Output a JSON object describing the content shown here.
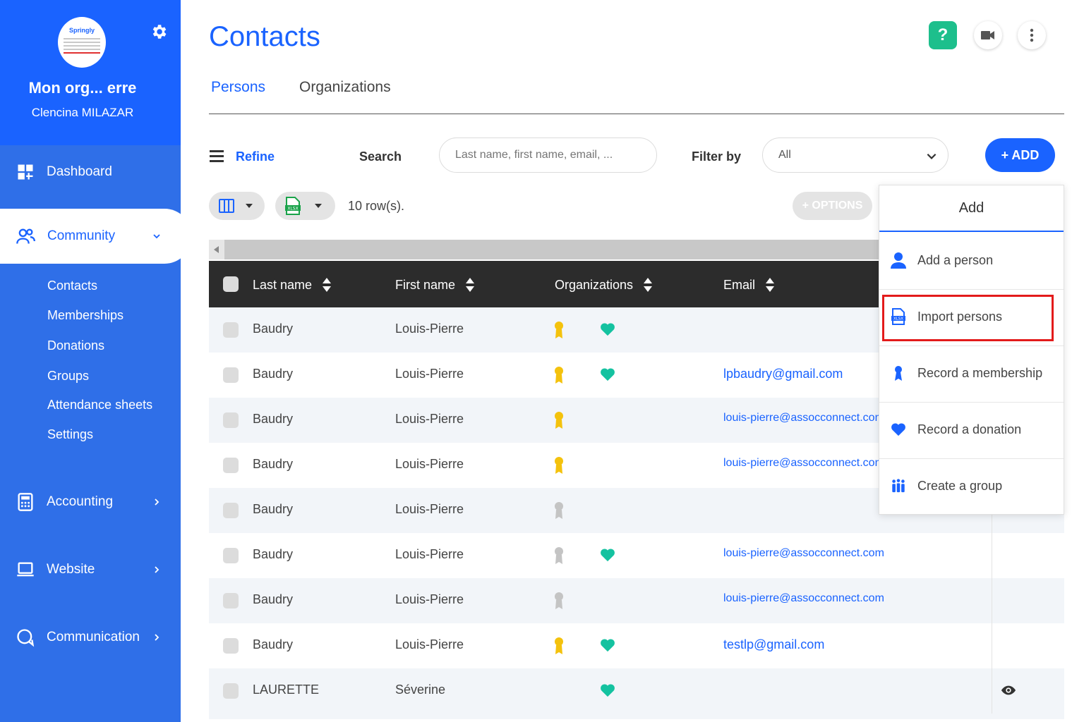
{
  "sidebar": {
    "logo_text": "Springly",
    "org_name": "Mon org... erre",
    "user_name": "Clencina MILAZAR",
    "nav": {
      "dashboard": "Dashboard",
      "community": "Community",
      "accounting": "Accounting",
      "website": "Website",
      "communication": "Communication"
    },
    "community_items": [
      "Contacts",
      "Memberships",
      "Donations",
      "Groups",
      "Attendance sheets",
      "Settings"
    ]
  },
  "header": {
    "title": "Contacts",
    "help_label": "?"
  },
  "tabs": [
    "Persons",
    "Organizations"
  ],
  "toolbar": {
    "refine_label": "Refine",
    "search_label": "Search",
    "search_placeholder": "Last name, first name, email, ...",
    "filter_label": "Filter by",
    "filter_value": "All",
    "add_label": "+ ADD",
    "rows_count": "10 row(s).",
    "options_label": "+ OPTIONS"
  },
  "table": {
    "columns": [
      "Last name",
      "First name",
      "Organizations",
      "Email"
    ],
    "rows": [
      {
        "last_name": "Baudry",
        "first_name": "Louis-Pierre",
        "badge": "gold",
        "heart": true,
        "email": ""
      },
      {
        "last_name": "Baudry",
        "first_name": "Louis-Pierre",
        "badge": "gold",
        "heart": true,
        "email": "lpbaudry@gmail.com"
      },
      {
        "last_name": "Baudry",
        "first_name": "Louis-Pierre",
        "badge": "gold",
        "heart": false,
        "email": "louis-pierre@assocconnect.com"
      },
      {
        "last_name": "Baudry",
        "first_name": "Louis-Pierre",
        "badge": "gold",
        "heart": false,
        "email": "louis-pierre@assocconnect.com"
      },
      {
        "last_name": "Baudry",
        "first_name": "Louis-Pierre",
        "badge": "grey",
        "heart": false,
        "email": ""
      },
      {
        "last_name": "Baudry",
        "first_name": "Louis-Pierre",
        "badge": "grey",
        "heart": true,
        "email": "louis-pierre@assocconnect.com"
      },
      {
        "last_name": "Baudry",
        "first_name": "Louis-Pierre",
        "badge": "grey",
        "heart": false,
        "email": "louis-pierre@assocconnect.com"
      },
      {
        "last_name": "Baudry",
        "first_name": "Louis-Pierre",
        "badge": "gold",
        "heart": true,
        "email": "testlp@gmail.com"
      },
      {
        "last_name": "LAURETTE",
        "first_name": "Séverine",
        "badge": "none",
        "heart": true,
        "email": ""
      }
    ]
  },
  "add_menu": {
    "title": "Add",
    "items": [
      {
        "label": "Add a person",
        "icon": "person-icon"
      },
      {
        "label": "Import persons",
        "icon": "xlsx-file-icon"
      },
      {
        "label": "Record a membership",
        "icon": "membership-badge-icon"
      },
      {
        "label": "Record a donation",
        "icon": "heart-icon"
      },
      {
        "label": "Create a group",
        "icon": "group-icon"
      }
    ]
  },
  "colors": {
    "brand_blue": "#1a63ff",
    "sidebar_blue": "#2f6fe8",
    "help_green": "#1dbf8c",
    "heart_teal": "#14c2a0",
    "badge_gold": "#f4c20d",
    "badge_grey": "#c4c4c4",
    "highlight_red": "#e31b1b"
  }
}
